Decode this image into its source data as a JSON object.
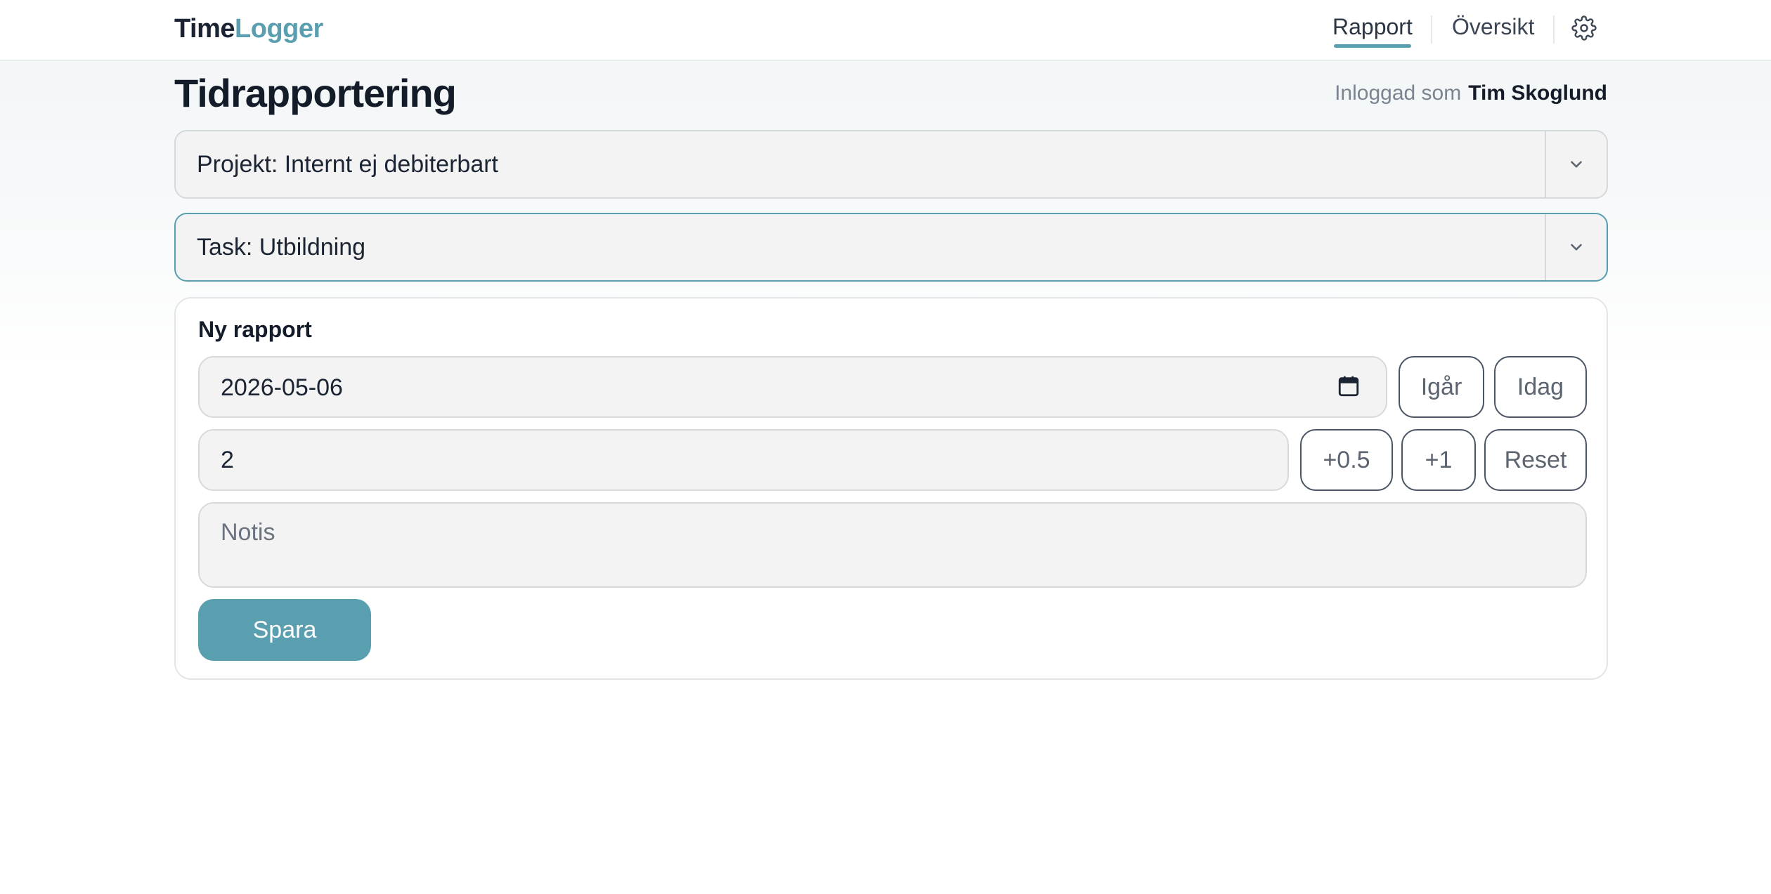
{
  "header": {
    "logo_part1": "Time",
    "logo_part2": "Logger",
    "nav": [
      {
        "label": "Rapport",
        "active": true
      },
      {
        "label": "Översikt",
        "active": false
      }
    ],
    "settings_icon": "gear-icon"
  },
  "page": {
    "title": "Tidrapportering",
    "logged_in_label": "Inloggad som",
    "user_name": "Tim Skoglund"
  },
  "selects": {
    "project": "Projekt: Internt ej debiterbart",
    "task": "Task: Utbildning"
  },
  "report": {
    "title": "Ny rapport",
    "date_value": "2026-05-06",
    "hours_value": "2",
    "notes_placeholder": "Notis",
    "btn_yesterday": "Igår",
    "btn_today": "Idag",
    "btn_half": "+0.5",
    "btn_one": "+1",
    "btn_reset": "Reset",
    "btn_save": "Spara"
  },
  "colors": {
    "accent": "#5a9fb0",
    "text_dark": "#141c29",
    "field_bg": "#f3f3f3"
  }
}
